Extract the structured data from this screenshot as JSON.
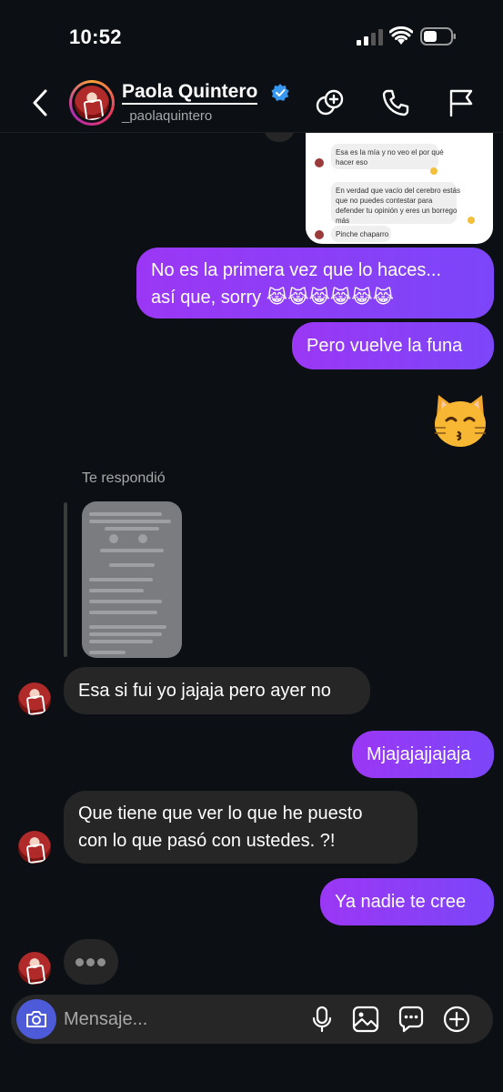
{
  "status": {
    "time": "10:52"
  },
  "header": {
    "name": "Paola Quintero",
    "handle": "_paolaquintero"
  },
  "shared_screenshot_top": {
    "lines": [
      "Esa es la mía y no veo el por qué",
      "hacer eso",
      "En verdad que vacío del cerebro estás",
      "que no puedes contestar para",
      "defender tu opinión y eres un borrego",
      "más",
      "Pinche chaparro"
    ]
  },
  "messages": {
    "m1_line1": "No es la primera vez que lo haces...",
    "m1_line2": "así que, sorry 😹😹😹😹😹😹",
    "m2": "Pero vuelve la funa",
    "reply_label": "Te respondió",
    "m3": "Esa si fui yo jajaja pero ayer no",
    "m4": "Mjajajajjajaja",
    "m5_line1": "Que tiene que ver lo que he puesto",
    "m5_line2": "con lo que pasó con ustedes. ?!",
    "m6": "Ya nadie te cree"
  },
  "composer": {
    "placeholder": "Mensaje..."
  },
  "colors": {
    "sent": "#8a3ffc",
    "received": "#262626",
    "background": "#0c1014",
    "camera": "#4d5bd8"
  },
  "icons": [
    "back-icon",
    "verified-icon",
    "add-people-icon",
    "phone-icon",
    "flag-icon",
    "camera-icon",
    "mic-icon",
    "gallery-icon",
    "sticker-icon",
    "plus-icon"
  ]
}
